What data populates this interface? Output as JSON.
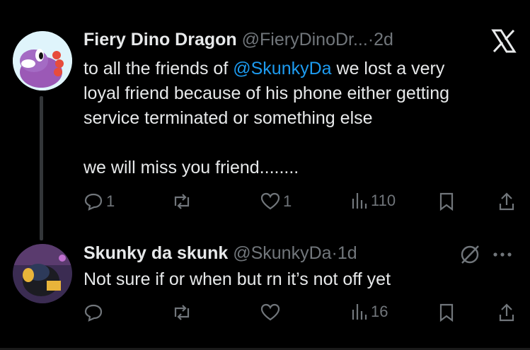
{
  "tweet1": {
    "author_name": "Fiery Dino Dragon",
    "handle": "@FieryDinoDr...",
    "separator": "·",
    "time": "2d",
    "text_prefix": "to all the friends of ",
    "mention": "@SkunkyDa",
    "text_line1_rest": " we lost a very",
    "text_line2": "loyal friend because of his phone either getting",
    "text_line3": "service terminated or something else",
    "text_line4": "we will miss you friend........",
    "replies": "1",
    "likes": "1",
    "views": "110",
    "platform_logo": "x-logo-icon"
  },
  "tweet2": {
    "author_name": "Skunky da skunk",
    "handle": "@SkunkyDa",
    "separator": "·",
    "time": "1d",
    "text": "Not sure if or when but rn it’s not off yet",
    "views": "16",
    "status_icon": "slash-circle-icon",
    "more_icon": "more-icon"
  },
  "colors": {
    "background": "#000000",
    "text": "#e7e9ea",
    "muted": "#71767b",
    "accent": "#1d9bf0"
  }
}
